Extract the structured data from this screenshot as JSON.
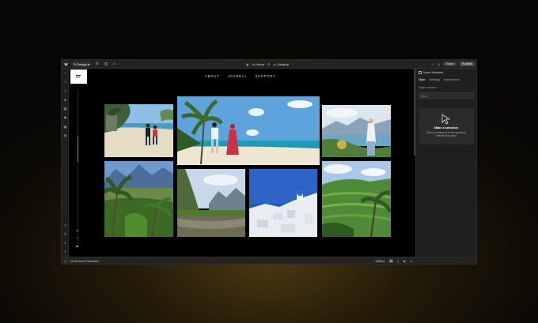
{
  "topbar": {
    "logo": "W",
    "mode_label": "Design",
    "page_label": "Home",
    "breakpoint_label": "Desktop",
    "share_label": "Share",
    "publish_label": "Publish"
  },
  "site": {
    "nav": [
      "ABOUT",
      "JOURNAL",
      "SUPPORT"
    ],
    "social": [
      "◎",
      "f",
      "▶"
    ]
  },
  "panel": {
    "selection_label": "None Selected",
    "tabs": [
      "Style",
      "Settings",
      "Interactions"
    ],
    "active_tab": "Style",
    "selector_label": "Style selector",
    "selector_value": "None",
    "empty_title": "Make a selection",
    "empty_desc": "Select an element on the canvas to activate this panel"
  },
  "bottombar": {
    "status": "No Element Selected",
    "width_label": "1062px"
  },
  "colors": {
    "accent": "#4a4a4a",
    "canvas_bg": "#000000",
    "app_bg": "#1c1c1c"
  }
}
